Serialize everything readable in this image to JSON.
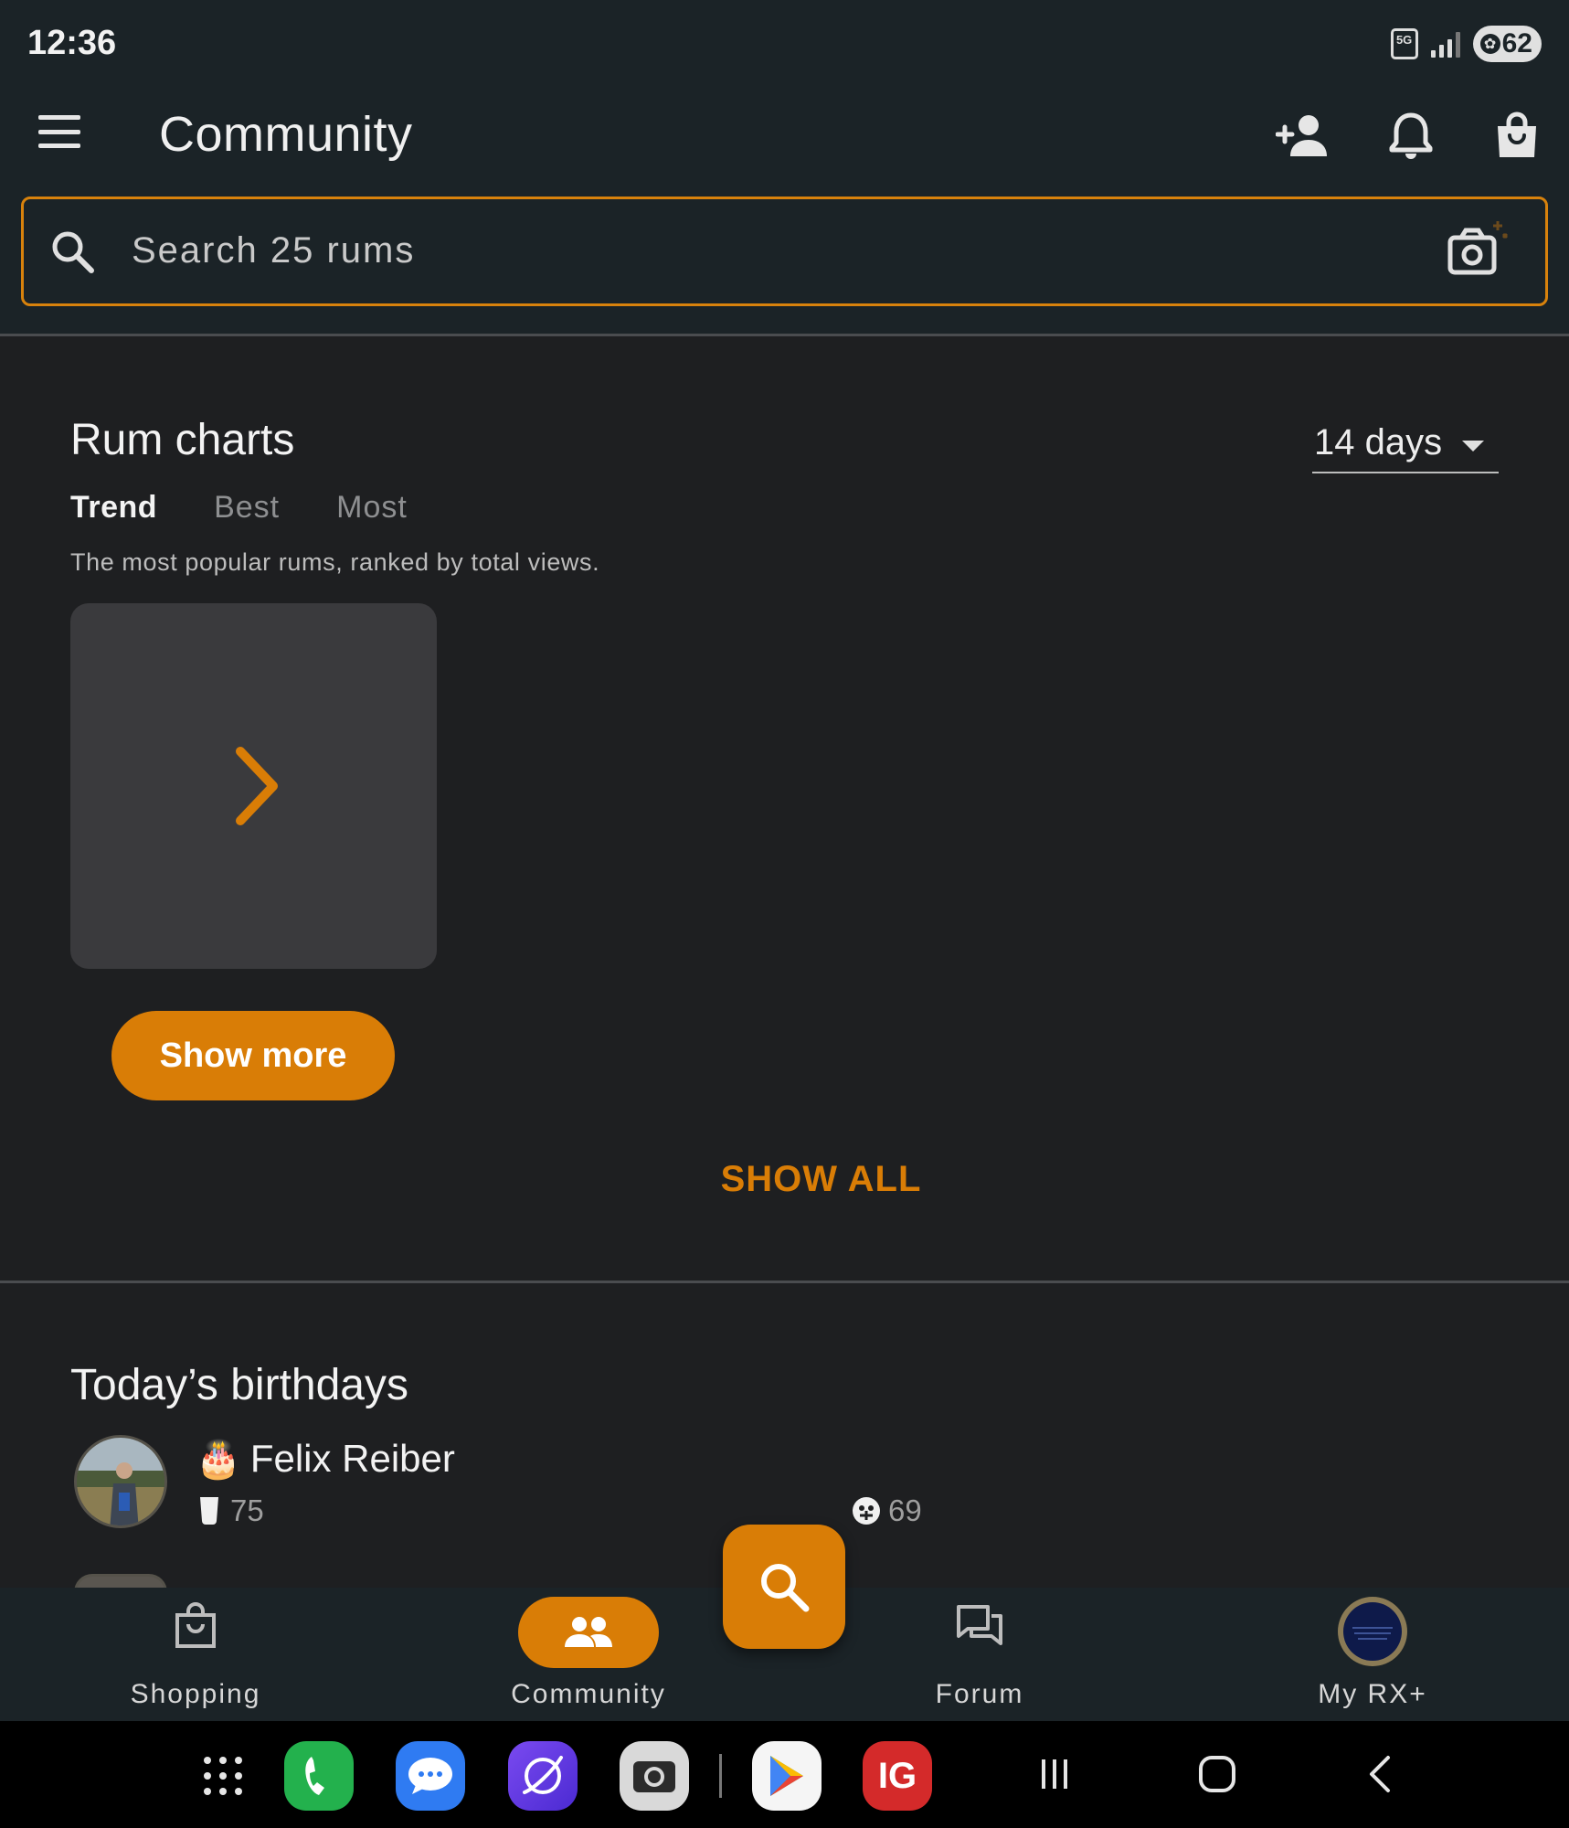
{
  "status_bar": {
    "time": "12:36",
    "network": "5G",
    "battery": "62"
  },
  "app_bar": {
    "title": "Community",
    "icons": [
      "menu-icon",
      "add-person-icon",
      "bell-icon",
      "shopping-bag-icon"
    ]
  },
  "search": {
    "placeholder": "Search 25 rums",
    "icons": [
      "search-icon",
      "camera-icon"
    ]
  },
  "rum_charts": {
    "title": "Rum charts",
    "period": "14 days",
    "tabs": [
      {
        "label": "Trend",
        "active": true
      },
      {
        "label": "Best",
        "active": false
      },
      {
        "label": "Most",
        "active": false
      }
    ],
    "description": "The most popular rums, ranked by total views.",
    "show_more_label": "Show more",
    "show_all_label": "SHOW ALL"
  },
  "birthdays": {
    "title": "Today’s birthdays",
    "people": [
      {
        "name": "Felix Reiber",
        "rum_count": "75",
        "rating_count": "69",
        "icons": [
          "birthday-cake-icon",
          "glass-icon",
          "face-icon"
        ]
      }
    ]
  },
  "bottom_nav": {
    "items": [
      {
        "label": "Shopping",
        "icon": "shopping-bag-icon",
        "active": false
      },
      {
        "label": "Community",
        "icon": "people-icon",
        "active": true
      },
      {
        "label": "Forum",
        "icon": "forum-icon",
        "active": false
      },
      {
        "label": "My RX+",
        "icon": "profile-avatar",
        "active": false
      }
    ],
    "fab_icon": "search-icon"
  },
  "system_nav": {
    "dock_apps": [
      "apps-grid-icon",
      "phone-app-icon",
      "messages-app-icon",
      "browser-app-icon",
      "camera-app-icon",
      "play-store-icon",
      "ig-app-icon"
    ],
    "ig_label": "IG",
    "buttons": [
      "recents-icon",
      "home-icon",
      "back-icon"
    ]
  },
  "colors": {
    "accent": "#d97d06",
    "app_bar_bg": "#1b2327",
    "page_bg": "#1e1f21",
    "card_bg": "#3a3a3d"
  }
}
